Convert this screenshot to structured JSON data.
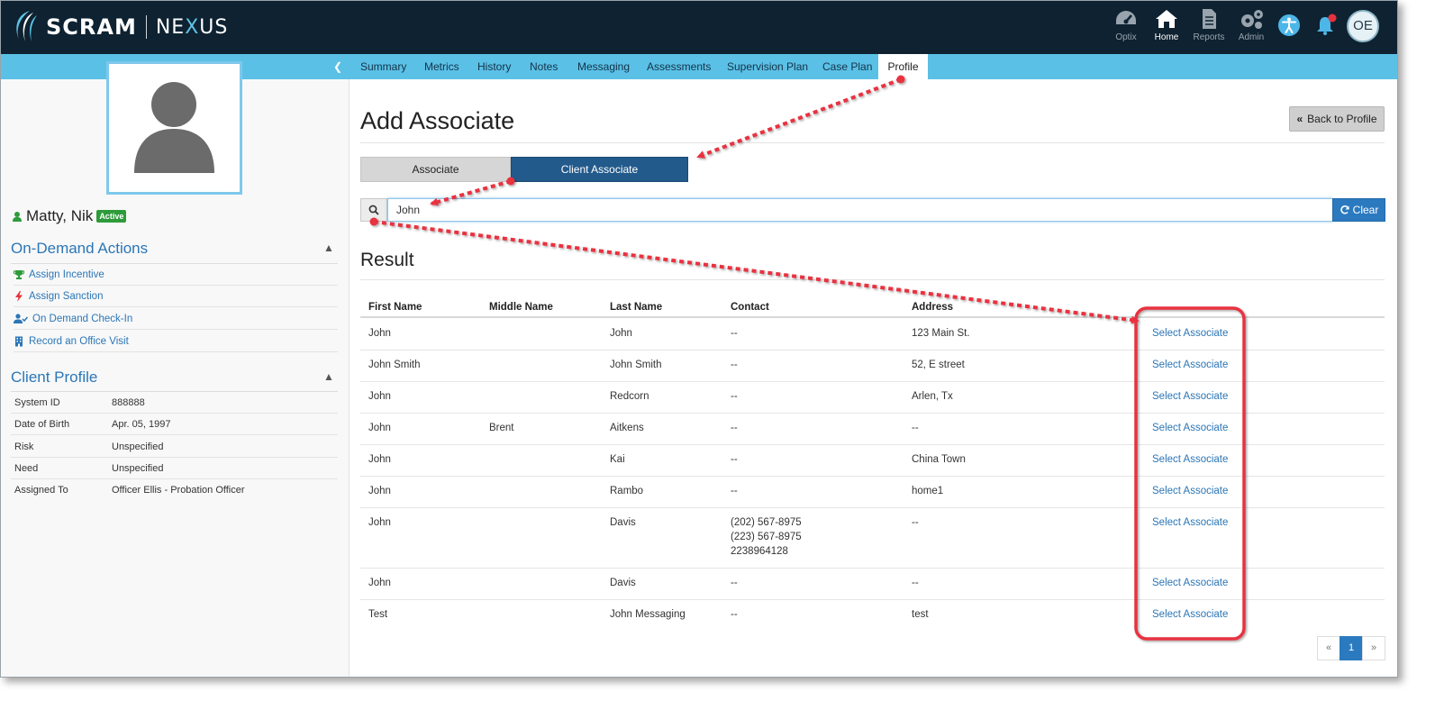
{
  "brand": {
    "name_left": "SCRAM",
    "name_right_pre": "NE",
    "name_right_x": "X",
    "name_right_post": "US"
  },
  "topnav": {
    "items": [
      {
        "label": "Optix",
        "icon": "gauge-icon"
      },
      {
        "label": "Home",
        "icon": "home-icon",
        "active": true
      },
      {
        "label": "Reports",
        "icon": "document-icon"
      },
      {
        "label": "Admin",
        "icon": "gears-icon"
      }
    ],
    "user_initials": "OE"
  },
  "sidebar": {
    "client_name": "Matty, Nik",
    "status_badge": "Active",
    "on_demand": {
      "title": "On-Demand Actions",
      "actions": [
        {
          "label": "Assign Incentive",
          "icon": "trophy-icon"
        },
        {
          "label": "Assign Sanction",
          "icon": "bolt-icon"
        },
        {
          "label": "On Demand Check-In",
          "icon": "user-check-icon"
        },
        {
          "label": "Record an Office Visit",
          "icon": "building-icon"
        }
      ]
    },
    "profile": {
      "title": "Client Profile",
      "rows": [
        {
          "key": "System ID",
          "value": "888888"
        },
        {
          "key": "Date of Birth",
          "value": "Apr. 05, 1997"
        },
        {
          "key": "Risk",
          "value": "Unspecified"
        },
        {
          "key": "Need",
          "value": "Unspecified"
        },
        {
          "key": "Assigned To",
          "value": "Officer Ellis - Probation Officer"
        }
      ]
    }
  },
  "tabs": [
    "Summary",
    "Metrics",
    "History",
    "Notes",
    "Messaging",
    "Assessments",
    "Supervision Plan",
    "Case Plan",
    "Profile"
  ],
  "active_tab": "Profile",
  "main": {
    "title": "Add Associate",
    "back_label": "Back to Profile",
    "toggle": {
      "associate": "Associate",
      "client_associate": "Client Associate",
      "selected": "Client Associate"
    },
    "search_value": "John",
    "clear_label": "Clear",
    "result_title": "Result",
    "columns": [
      "First Name",
      "Middle Name",
      "Last Name",
      "Contact",
      "Address"
    ],
    "select_label": "Select Associate",
    "rows": [
      {
        "first": "John",
        "middle": "",
        "last": "John",
        "contact": "--",
        "address": "123 Main St."
      },
      {
        "first": "John Smith",
        "middle": "",
        "last": "John Smith",
        "contact": "--",
        "address": "52, E street"
      },
      {
        "first": "John",
        "middle": "",
        "last": "Redcorn",
        "contact": "--",
        "address": "Arlen, Tx"
      },
      {
        "first": "John",
        "middle": "Brent",
        "last": "Aitkens",
        "contact": "--",
        "address": "--"
      },
      {
        "first": "John",
        "middle": "",
        "last": "Kai",
        "contact": "--",
        "address": "China Town"
      },
      {
        "first": "John",
        "middle": "",
        "last": "Rambo",
        "contact": "--",
        "address": "home1"
      },
      {
        "first": "John",
        "middle": "",
        "last": "Davis",
        "contact": "(202) 567-8975\n(223) 567-8975\n2238964128",
        "address": "--"
      },
      {
        "first": "John",
        "middle": "",
        "last": "Davis",
        "contact": "--",
        "address": "--"
      },
      {
        "first": "Test",
        "middle": "",
        "last": "John Messaging",
        "contact": "--",
        "address": "test"
      }
    ],
    "pagination": {
      "prev": "«",
      "current": "1",
      "next": "»"
    }
  },
  "colors": {
    "navbar": "#0e2231",
    "accent_strip": "#5bc0e6",
    "primary": "#235a8c",
    "link": "#2b76b6",
    "annotation": "#e8333f"
  }
}
